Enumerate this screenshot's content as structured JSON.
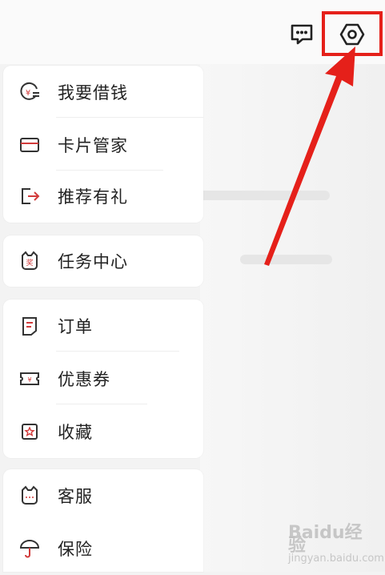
{
  "menu": {
    "group1": [
      {
        "label": "我要借钱",
        "icon": "loan-yen-icon"
      },
      {
        "label": "卡片管家",
        "icon": "card-icon"
      },
      {
        "label": "推荐有礼",
        "icon": "share-exit-icon"
      }
    ],
    "group2": [
      {
        "label": "任务中心",
        "icon": "task-cat-icon"
      }
    ],
    "group3": [
      {
        "label": "订单",
        "icon": "order-icon"
      },
      {
        "label": "优惠券",
        "icon": "coupon-icon"
      },
      {
        "label": "收藏",
        "icon": "favorite-star-icon"
      }
    ],
    "group4": [
      {
        "label": "客服",
        "icon": "customer-service-icon"
      },
      {
        "label": "保险",
        "icon": "umbrella-icon"
      }
    ]
  },
  "watermark": {
    "brand": "Baidu经验",
    "sub": "jingyan.baidu.com"
  },
  "colors": {
    "accent": "#e5201a",
    "icon_red": "#d23b3b"
  }
}
